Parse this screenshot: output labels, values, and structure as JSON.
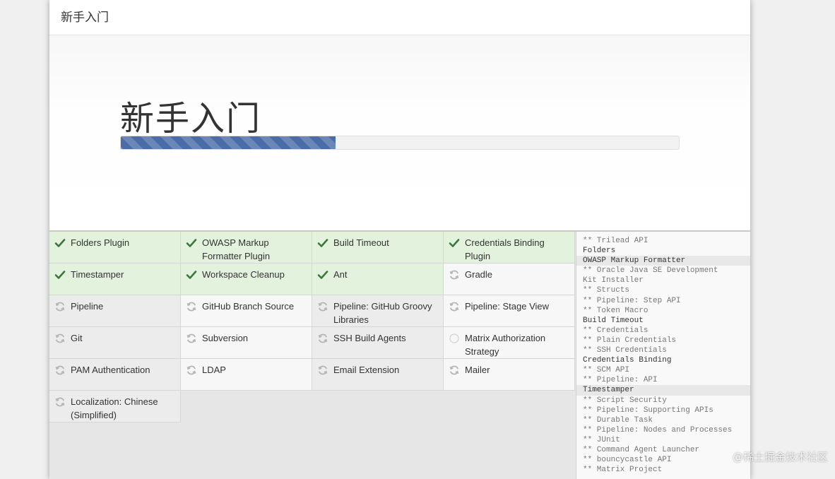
{
  "header": {
    "title": "新手入门"
  },
  "hero": {
    "title": "新手入门",
    "progress": 0.385
  },
  "plugins": [
    {
      "label": "Folders Plugin",
      "state": "done"
    },
    {
      "label": "OWASP Markup Formatter Plugin",
      "state": "done"
    },
    {
      "label": "Build Timeout",
      "state": "done"
    },
    {
      "label": "Credentials Binding Plugin",
      "state": "done"
    },
    {
      "label": "Timestamper",
      "state": "done"
    },
    {
      "label": "Workspace Cleanup",
      "state": "done"
    },
    {
      "label": "Ant",
      "state": "done"
    },
    {
      "label": "Gradle",
      "state": "pending"
    },
    {
      "label": "Pipeline",
      "state": "pending"
    },
    {
      "label": "GitHub Branch Source",
      "state": "pending"
    },
    {
      "label": "Pipeline: GitHub Groovy Libraries",
      "state": "pending"
    },
    {
      "label": "Pipeline: Stage View",
      "state": "pending"
    },
    {
      "label": "Git",
      "state": "pending"
    },
    {
      "label": "Subversion",
      "state": "pending"
    },
    {
      "label": "SSH Build Agents",
      "state": "pending"
    },
    {
      "label": "Matrix Authorization Strategy",
      "state": "queued"
    },
    {
      "label": "PAM Authentication",
      "state": "pending"
    },
    {
      "label": "LDAP",
      "state": "pending"
    },
    {
      "label": "Email Extension",
      "state": "pending"
    },
    {
      "label": "Mailer",
      "state": "pending"
    },
    {
      "label": "Localization: Chinese (Simplified)",
      "state": "pending"
    }
  ],
  "log": [
    {
      "text": "** Trilead API",
      "style": "dim"
    },
    {
      "text": "Folders",
      "style": ""
    },
    {
      "text": "OWASP Markup Formatter",
      "style": "hl"
    },
    {
      "text": "** Oracle Java SE Development",
      "style": "dim"
    },
    {
      "text": "Kit Installer",
      "style": "dim"
    },
    {
      "text": "** Structs",
      "style": "dim"
    },
    {
      "text": "** Pipeline: Step API",
      "style": "dim"
    },
    {
      "text": "** Token Macro",
      "style": "dim"
    },
    {
      "text": "Build Timeout",
      "style": ""
    },
    {
      "text": "** Credentials",
      "style": "dim"
    },
    {
      "text": "** Plain Credentials",
      "style": "dim"
    },
    {
      "text": "** SSH Credentials",
      "style": "dim"
    },
    {
      "text": "Credentials Binding",
      "style": ""
    },
    {
      "text": "** SCM API",
      "style": "dim"
    },
    {
      "text": "** Pipeline: API",
      "style": "dim"
    },
    {
      "text": "Timestamper",
      "style": "hl"
    },
    {
      "text": "** Script Security",
      "style": "dim"
    },
    {
      "text": "** Pipeline: Supporting APIs",
      "style": "dim"
    },
    {
      "text": "** Durable Task",
      "style": "dim"
    },
    {
      "text": "** Pipeline: Nodes and Processes",
      "style": "dim"
    },
    {
      "text": "** JUnit",
      "style": "dim"
    },
    {
      "text": "** Command Agent Launcher",
      "style": "dim"
    },
    {
      "text": "** bouncycastle API",
      "style": "dim"
    },
    {
      "text": "** Matrix Project",
      "style": "dim"
    }
  ],
  "watermark": "@稀土掘金技术社区",
  "colors": {
    "done_bg": "#e3f2dc",
    "check": "#3c763d",
    "progress": "#4a6da7",
    "spinner": "#b5b5b5"
  },
  "icons": {
    "done": "check-icon",
    "pending": "refresh-icon",
    "queued": "circle-icon"
  }
}
